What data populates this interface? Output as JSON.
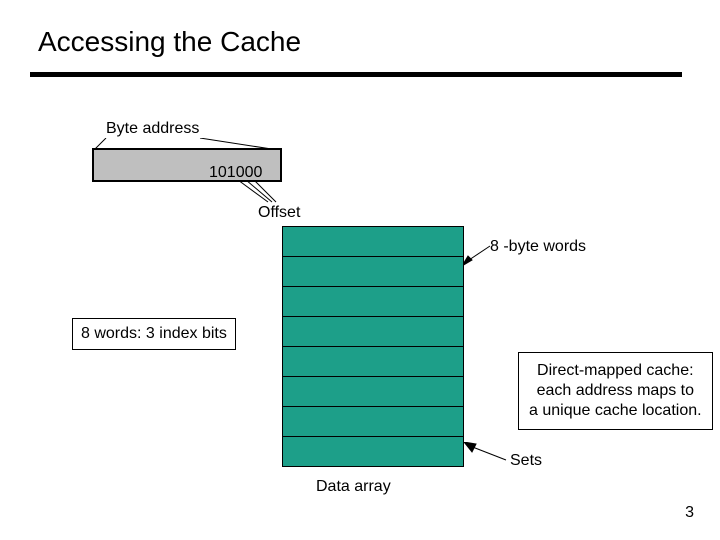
{
  "title": "Accessing the Cache",
  "byte_address_label": "Byte address",
  "address_value": "101000",
  "offset_label": "Offset",
  "eight_byte_words_label": "8 -byte words",
  "index_note": "8 words: 3 index bits",
  "direct_mapped_line1": "Direct-mapped cache:",
  "direct_mapped_line2": "each address maps to",
  "direct_mapped_line3": "a unique cache location.",
  "sets_label": "Sets",
  "data_array_label": "Data array",
  "slide_number": "3",
  "data_array_rows": 8
}
